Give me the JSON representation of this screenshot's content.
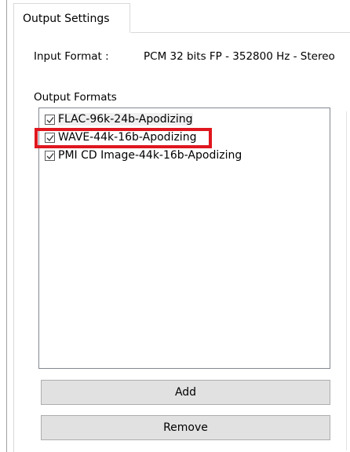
{
  "tab": {
    "label": "Output Settings"
  },
  "input_format": {
    "label": "Input Format :",
    "value": "PCM 32 bits FP - 352800 Hz - Stereo"
  },
  "output_formats": {
    "label": "Output Formats",
    "items": [
      {
        "label": "FLAC-96k-24b-Apodizing",
        "checked": true
      },
      {
        "label": "WAVE-44k-16b-Apodizing",
        "checked": true,
        "highlighted": true
      },
      {
        "label": "PMI CD Image-44k-16b-Apodizing",
        "checked": true
      }
    ]
  },
  "buttons": {
    "add": "Add",
    "remove": "Remove"
  },
  "colors": {
    "highlight": "#e0161e",
    "button_bg": "#e1e1e1",
    "list_border": "#828790"
  }
}
